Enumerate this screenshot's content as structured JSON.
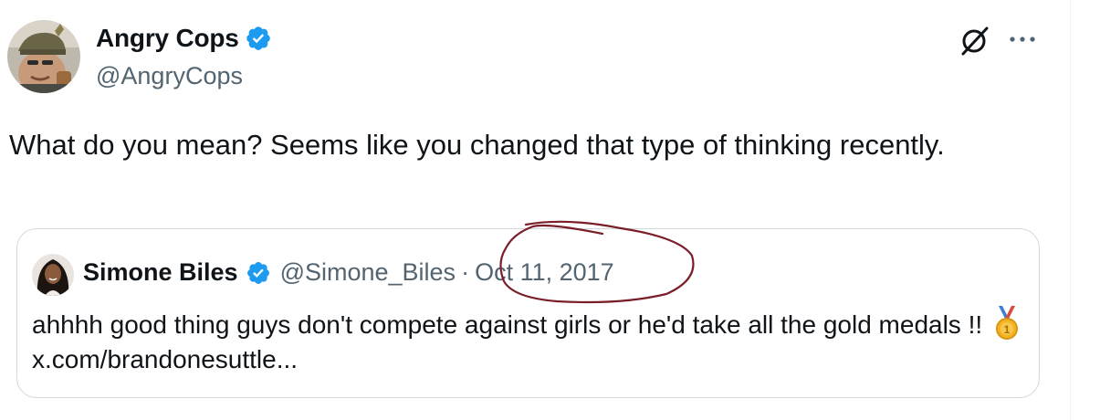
{
  "tweet": {
    "author_name": "Angry Cops",
    "author_handle": "@AngryCops",
    "text": "What do you mean? Seems like you changed that type of thinking recently."
  },
  "quote": {
    "author_name": "Simone Biles",
    "author_handle": "@Simone_Biles",
    "separator": "·",
    "date": "Oct 11, 2017",
    "text": "ahhhh good thing guys don't compete against girls or he'd take all the gold medals !!",
    "link": "x.com/brandonesuttle..."
  },
  "icons": {
    "verified": "verified-badge-icon",
    "grok": "grok-icon",
    "more": "more-options-icon",
    "medal": "first-place-medal-icon"
  },
  "colors": {
    "verified_blue": "#1d9bf0",
    "secondary_text": "#536471",
    "primary_text": "#0f1419",
    "annotation": "#7a1e28"
  }
}
